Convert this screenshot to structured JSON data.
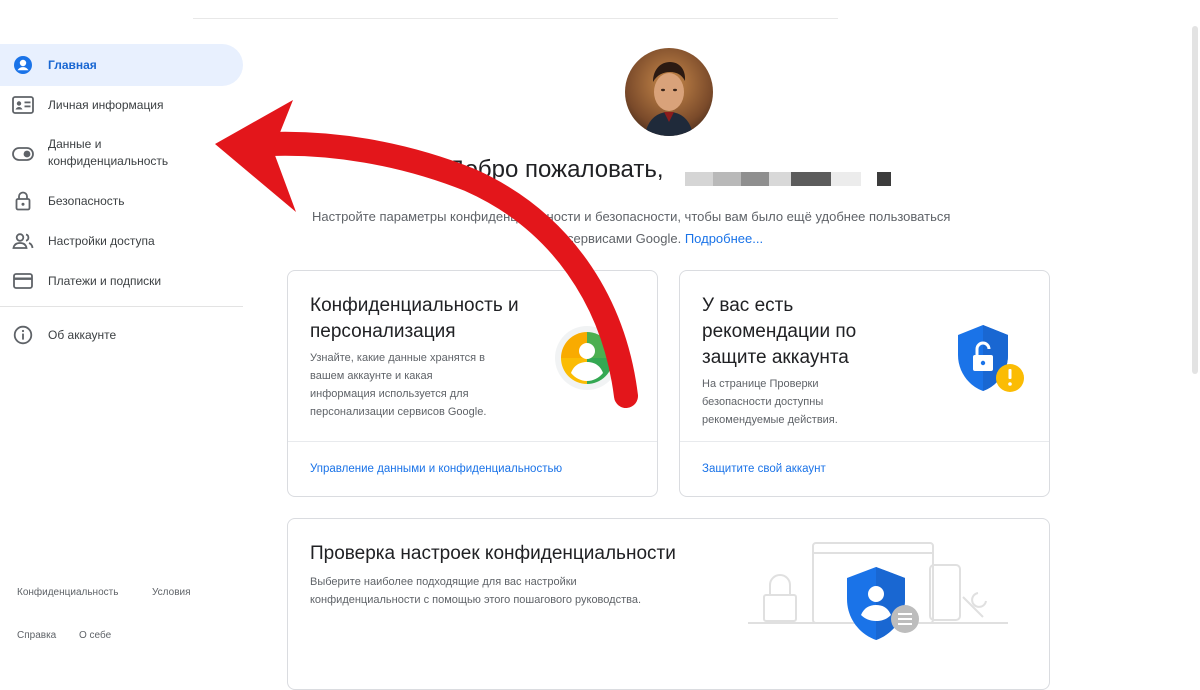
{
  "sidebar": {
    "items": [
      {
        "label": "Главная",
        "icon": "account-circle-icon"
      },
      {
        "label": "Личная информация",
        "icon": "id-card-icon"
      },
      {
        "label": "Данные и",
        "label2": "конфиденциальность",
        "icon": "toggle-icon"
      },
      {
        "label": "Безопасность",
        "icon": "lock-icon"
      },
      {
        "label": "Настройки доступа",
        "icon": "people-icon"
      },
      {
        "label": "Платежи и подписки",
        "icon": "credit-card-icon"
      },
      {
        "label": "Об аккаунте",
        "icon": "info-icon"
      }
    ],
    "footer": {
      "privacy": "Конфиденциальность",
      "terms": "Условия",
      "help": "Справка",
      "about": "О себе"
    }
  },
  "header": {
    "welcome": "Добро пожаловать,",
    "subtitle_line1": "Настройте параметры конфиденциальности и безопасности, чтобы вам было ещё удобнее пользоваться",
    "subtitle_line2": "сервисами Google.",
    "more_link": "Подробнее..."
  },
  "cards": {
    "privacy": {
      "title_line1": "Конфиденциальность и",
      "title_line2": "персонализация",
      "desc": [
        "Узнайте, какие данные хранятся в",
        "вашем аккаунте и какая",
        "информация используется для",
        "персонализации сервисов Google."
      ],
      "link": "Управление данными и конфиденциальностью",
      "icon": "privacy-person-icon"
    },
    "security": {
      "title_line1": "У вас есть",
      "title_line2": "рекомендации по",
      "title_line3": "защите аккаунта",
      "desc": [
        "На странице Проверки",
        "безопасности доступны",
        "рекомендуемые действия."
      ],
      "link": "Защитите свой аккаунт",
      "icon": "shield-lock-warning-icon"
    },
    "checkup": {
      "title": "Проверка настроек конфиденциальности",
      "desc": [
        "Выберите наиболее подходящие для вас настройки",
        "конфиденциальности с помощью этого пошагового руководства."
      ],
      "icon": "privacy-checkup-illustration-icon"
    }
  },
  "colors": {
    "accent": "#1a73e8",
    "active_bg": "#e8f0fe",
    "arrow": "#e3161b",
    "text": "#202124",
    "muted": "#5f6368"
  }
}
